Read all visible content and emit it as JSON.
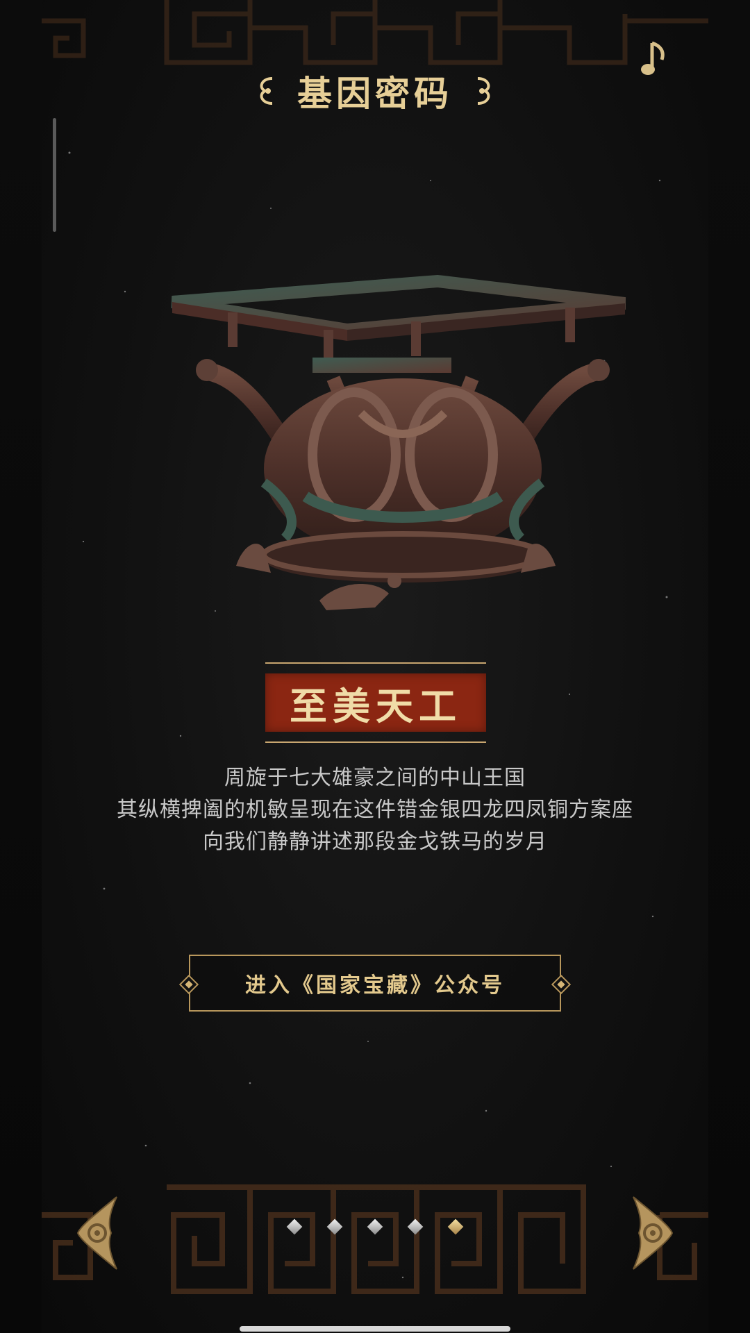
{
  "header": {
    "title": "基因密码",
    "music_icon": "music-note-icon"
  },
  "artifact": {
    "image": "bronze-square-table-base-illustration"
  },
  "banner": {
    "title": "至美天工"
  },
  "description": {
    "lines": [
      "周旋于七大雄豪之间的中山王国",
      "其纵横捭阖的机敏呈现在这件错金银四龙四凤铜方案座",
      "向我们静静讲述那段金戈铁马的岁月"
    ]
  },
  "cta": {
    "label": "进入《国家宝藏》公众号"
  },
  "navigation": {
    "prev_icon": "ornate-arrow-left-icon",
    "next_icon": "ornate-arrow-right-icon",
    "page_count": 5,
    "active_page": 5
  },
  "colors": {
    "gold": "#e7cf97",
    "banner_red": "#8b2612",
    "text": "#c9c9c9",
    "background": "#111111"
  }
}
